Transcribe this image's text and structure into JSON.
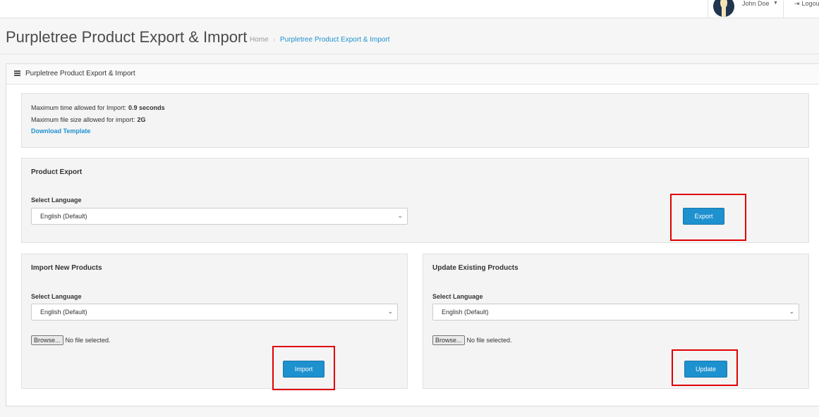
{
  "topbar": {
    "user_name": "John Doe",
    "caret": "▼",
    "logout_label": "Logou"
  },
  "header": {
    "title": "Purpletree Product Export & Import",
    "breadcrumb": {
      "home": "Home",
      "separator": "›",
      "current": "Purpletree Product Export & Import"
    }
  },
  "panel": {
    "title": "Purpletree Product Export & Import",
    "info": {
      "max_time_label": "Maximum time allowed for Import:",
      "max_time_value": "0.9 seconds",
      "max_size_label": "Maximum file size allowed for import:",
      "max_size_value": "2G",
      "download_link": "Download Template"
    },
    "export": {
      "title": "Product Export",
      "language_label": "Select Language",
      "language_value": "English (Default)",
      "button": "Export"
    },
    "import_new": {
      "title": "Import New Products",
      "language_label": "Select Language",
      "language_value": "English (Default)",
      "browse": "Browse...",
      "file_status": "No file selected.",
      "button": "Import"
    },
    "update_existing": {
      "title": "Update Existing Products",
      "language_label": "Select Language",
      "language_value": "English (Default)",
      "browse": "Browse...",
      "file_status": "No file selected.",
      "button": "Update"
    }
  },
  "colors": {
    "accent": "#1e91cf",
    "highlight": "#e00000"
  },
  "icons": {
    "list": "list-icon",
    "logout": "sign-out-icon",
    "chevron": "chevron-down-icon"
  }
}
